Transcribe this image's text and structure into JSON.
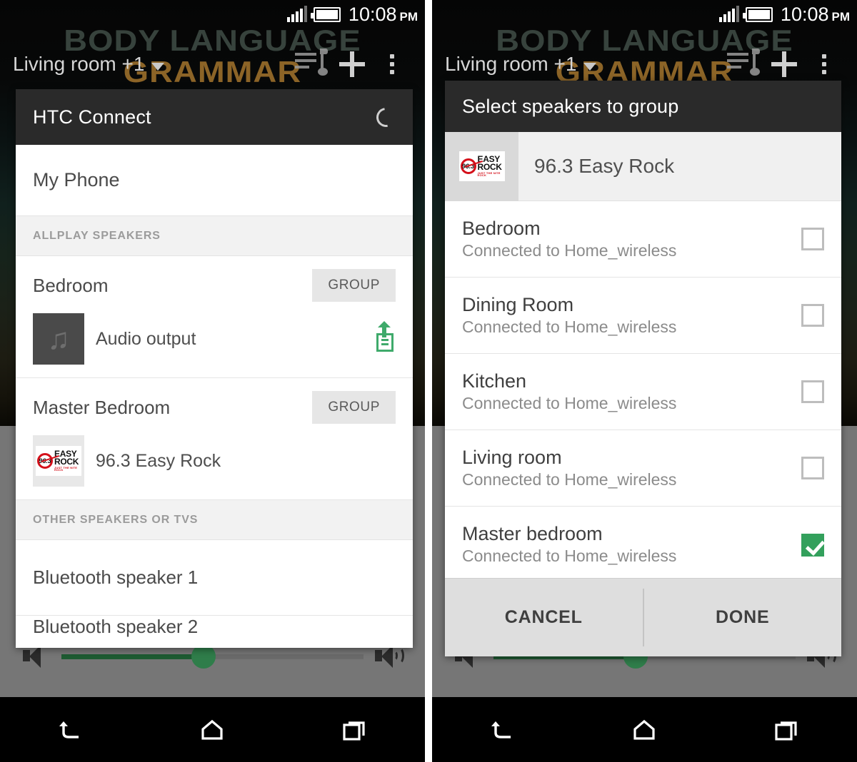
{
  "status_bar": {
    "time": "10:08",
    "ampm": "PM",
    "signal_icon": "signal-bars-icon",
    "battery_icon": "battery-icon"
  },
  "app_bar": {
    "title": "Living room +1",
    "dropdown_icon": "chevron-down-icon",
    "playlist_icon": "playlist-music-icon",
    "add_icon": "plus-icon",
    "overflow_icon": "overflow-menu-icon"
  },
  "background_art": {
    "line1": "BODY LANGUAGE",
    "line2": "GRAMMAR"
  },
  "volume": {
    "mute_icon": "speaker-mute-icon",
    "loud_icon": "speaker-loud-icon",
    "level_percent": 47
  },
  "nav_bar": {
    "back_label": "back-button",
    "home_label": "home-button",
    "recents_label": "recents-button"
  },
  "left_dialog": {
    "title": "HTC Connect",
    "spinner_icon": "loading-spinner-icon",
    "my_phone": "My Phone",
    "section_allplay": "ALLPLAY SPEAKERS",
    "section_other": "OTHER SPEAKERS OR TVS",
    "speakers": [
      {
        "name": "Bedroom",
        "group_label": "GROUP",
        "now_playing": "Audio output",
        "art_type": "music-note",
        "push_icon": "push-to-speaker-icon"
      },
      {
        "name": "Master Bedroom",
        "group_label": "GROUP",
        "now_playing": "96.3 Easy Rock",
        "art_type": "easy-rock-logo",
        "push_icon": ""
      }
    ],
    "other_devices": [
      "Bluetooth speaker 1",
      "Bluetooth speaker 2"
    ]
  },
  "right_dialog": {
    "title": "Select speakers to group",
    "now_playing": {
      "label": "96.3 Easy Rock",
      "art_type": "easy-rock-logo"
    },
    "speakers": [
      {
        "name": "Bedroom",
        "status": "Connected to Home_wireless",
        "checked": false
      },
      {
        "name": "Dining Room",
        "status": "Connected to Home_wireless",
        "checked": false
      },
      {
        "name": "Kitchen",
        "status": "Connected to Home_wireless",
        "checked": false
      },
      {
        "name": "Living room",
        "status": "Connected to Home_wireless",
        "checked": false
      },
      {
        "name": "Master bedroom",
        "status": "Connected to Home_wireless",
        "checked": true
      }
    ],
    "cancel_label": "CANCEL",
    "done_label": "DONE"
  },
  "easy_rock_logo": {
    "freq": "96.3",
    "word1": "EASY",
    "word2": "ROCK",
    "tagline": "JUST THE NITE ROCK"
  },
  "colors": {
    "accent_green": "#33a05c",
    "push_green": "#3faa6b",
    "header_dark": "#2a2a2a",
    "logo_red": "#d4101a",
    "art_orange": "#c48c34"
  }
}
